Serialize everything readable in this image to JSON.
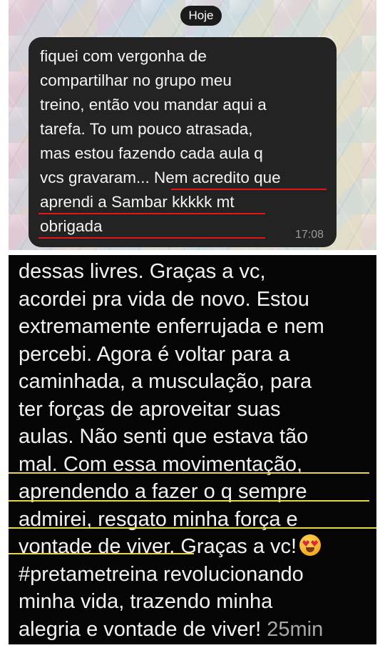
{
  "top_chat": {
    "date_label": "Hoje",
    "message_lines": [
      "fiquei com vergonha de",
      "compartilhar no grupo meu",
      "treino, então vou mandar aqui a",
      "tarefa. To um pouco atrasada,",
      "mas estou fazendo cada aula q",
      "vcs gravaram... Nem acredito que",
      "aprendi a Sambar kkkkk mt",
      "obrigada"
    ],
    "time": "17:08",
    "underline_color": "#e3171b"
  },
  "bottom_chat": {
    "message_lines": [
      "dessas livres. Graças a vc,",
      "acordei pra vida de novo. Estou",
      "extremamente enferrujada e nem",
      "percebi. Agora é voltar para a",
      "caminhada, a musculação, para",
      "ter forças de aproveitar suas",
      "aulas. Não senti que estava tão",
      "mal. Com essa movimentação,",
      "aprendendo a fazer o q sempre",
      "admirei, resgato minha força e",
      "vontade de viver. Graças a vc!",
      "#pretametreina revolucionando",
      "minha vida, trazendo minha",
      "alegria e vontade de viver!"
    ],
    "emoji": "heart-eyes-emoji",
    "time": "25min",
    "underline_color": "#e9d44a"
  }
}
